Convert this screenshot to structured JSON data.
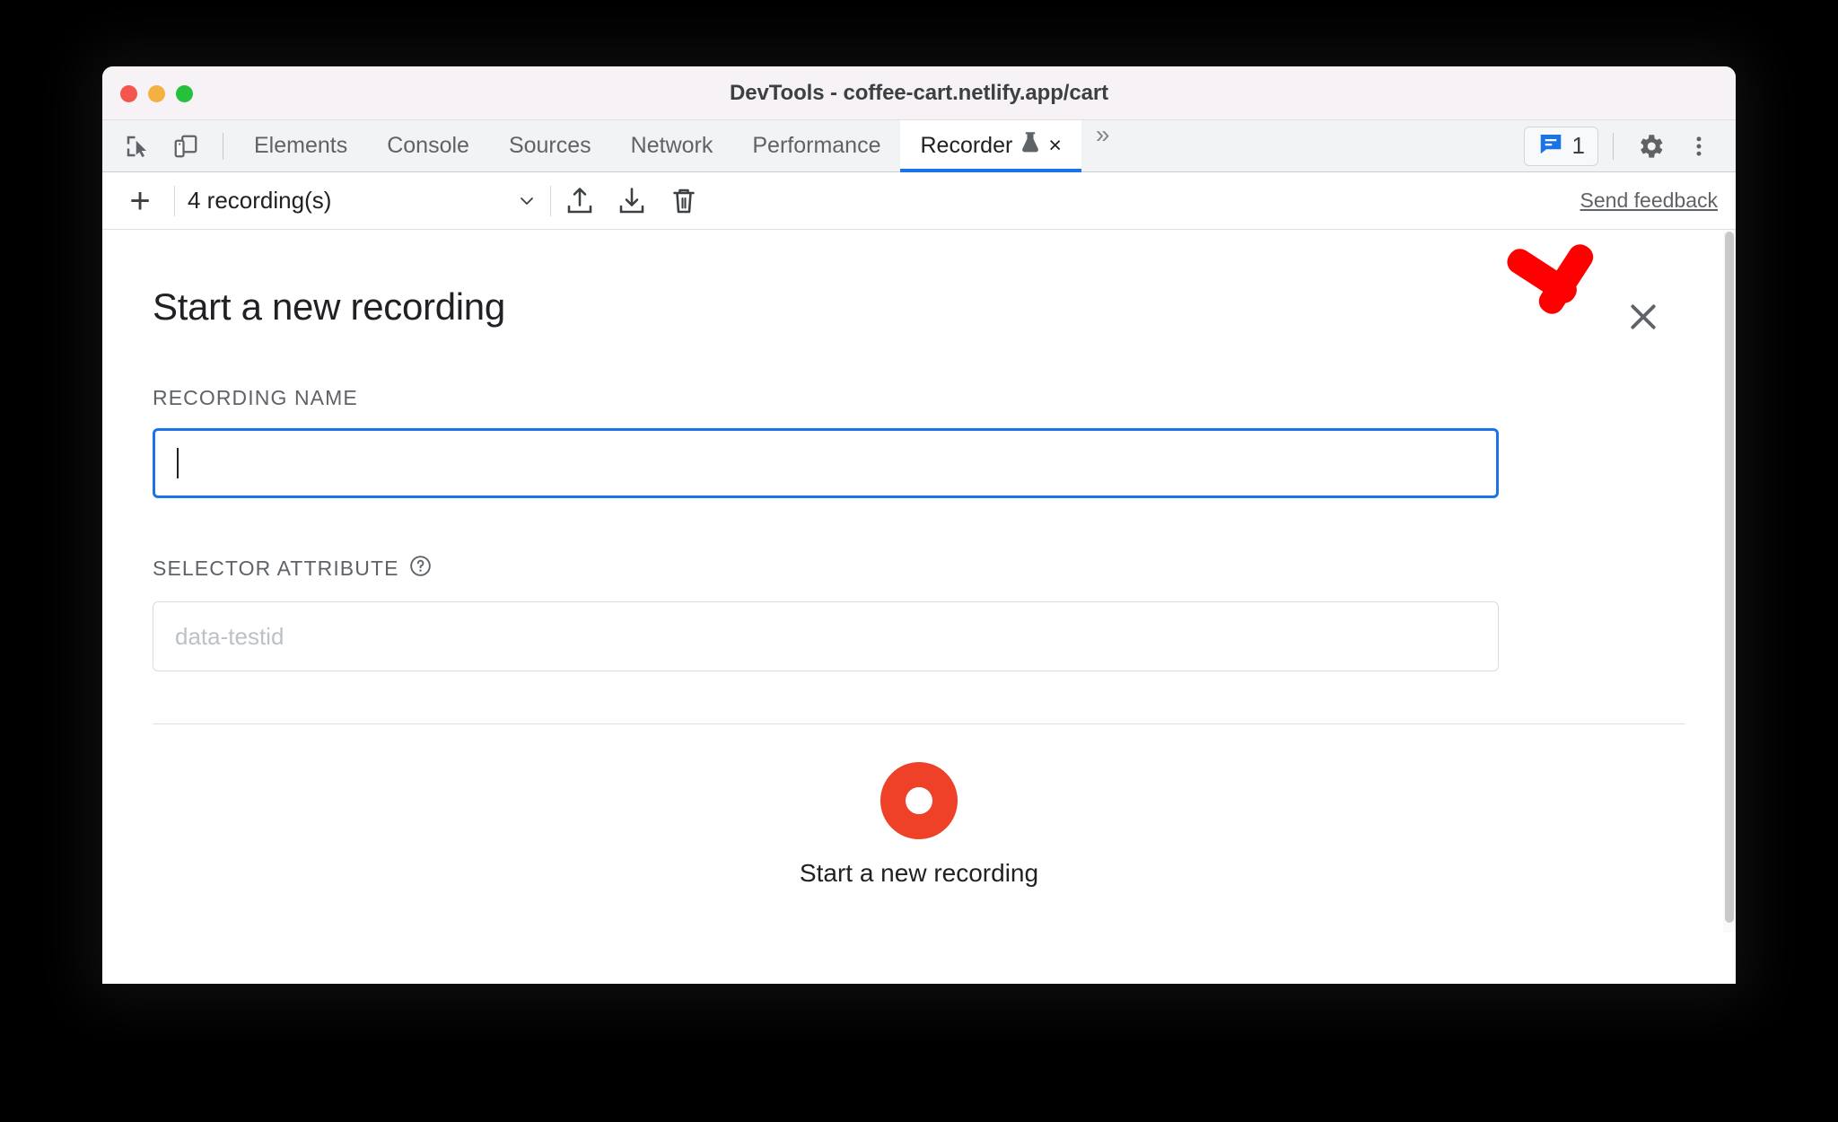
{
  "window": {
    "title": "DevTools - coffee-cart.netlify.app/cart",
    "traffic_lights": [
      "close",
      "minimize",
      "zoom"
    ],
    "colors": {
      "close": "#f2564c",
      "minimize": "#f4b142",
      "zoom": "#25c03c"
    }
  },
  "tabbar": {
    "left_icons": [
      {
        "name": "inspect-element-icon",
        "label": "Inspect element"
      },
      {
        "name": "device-toolbar-icon",
        "label": "Toggle device toolbar"
      }
    ],
    "tabs": [
      {
        "label": "Elements",
        "active": false
      },
      {
        "label": "Console",
        "active": false
      },
      {
        "label": "Sources",
        "active": false
      },
      {
        "label": "Network",
        "active": false
      },
      {
        "label": "Performance",
        "active": false
      },
      {
        "label": "Recorder",
        "active": true,
        "experimental": true,
        "closeable": true
      }
    ],
    "tab_close_glyph": "×",
    "more_tabs_glyph": "»",
    "messages": {
      "count": "1",
      "icon": "message-icon",
      "color": "#1a73e8"
    },
    "settings_icon": "gear-icon",
    "menu_icon": "kebab-menu-icon"
  },
  "recorder_toolbar": {
    "add_label": "+",
    "recordings_select": "4 recording(s)",
    "icons": [
      {
        "name": "import-icon",
        "label": "Import recording"
      },
      {
        "name": "export-icon",
        "label": "Export recording"
      },
      {
        "name": "delete-icon",
        "label": "Delete recording"
      }
    ],
    "send_feedback": "Send feedback"
  },
  "panel": {
    "title": "Start a new recording",
    "close_label": "×",
    "fields": [
      {
        "label": "RECORDING NAME",
        "value": "",
        "placeholder": "",
        "focused": true,
        "help": false
      },
      {
        "label": "SELECTOR ATTRIBUTE",
        "value": "",
        "placeholder": "data-testid",
        "focused": false,
        "help": true,
        "help_glyph": "?"
      }
    ],
    "record_button": {
      "caption": "Start a new recording",
      "color": "#ee4128",
      "icon": "record-circle-icon"
    }
  },
  "annotation": {
    "arrow": {
      "name": "red-arrow-annotation",
      "color": "#ff0000",
      "points_to": "close-panel-button"
    }
  }
}
